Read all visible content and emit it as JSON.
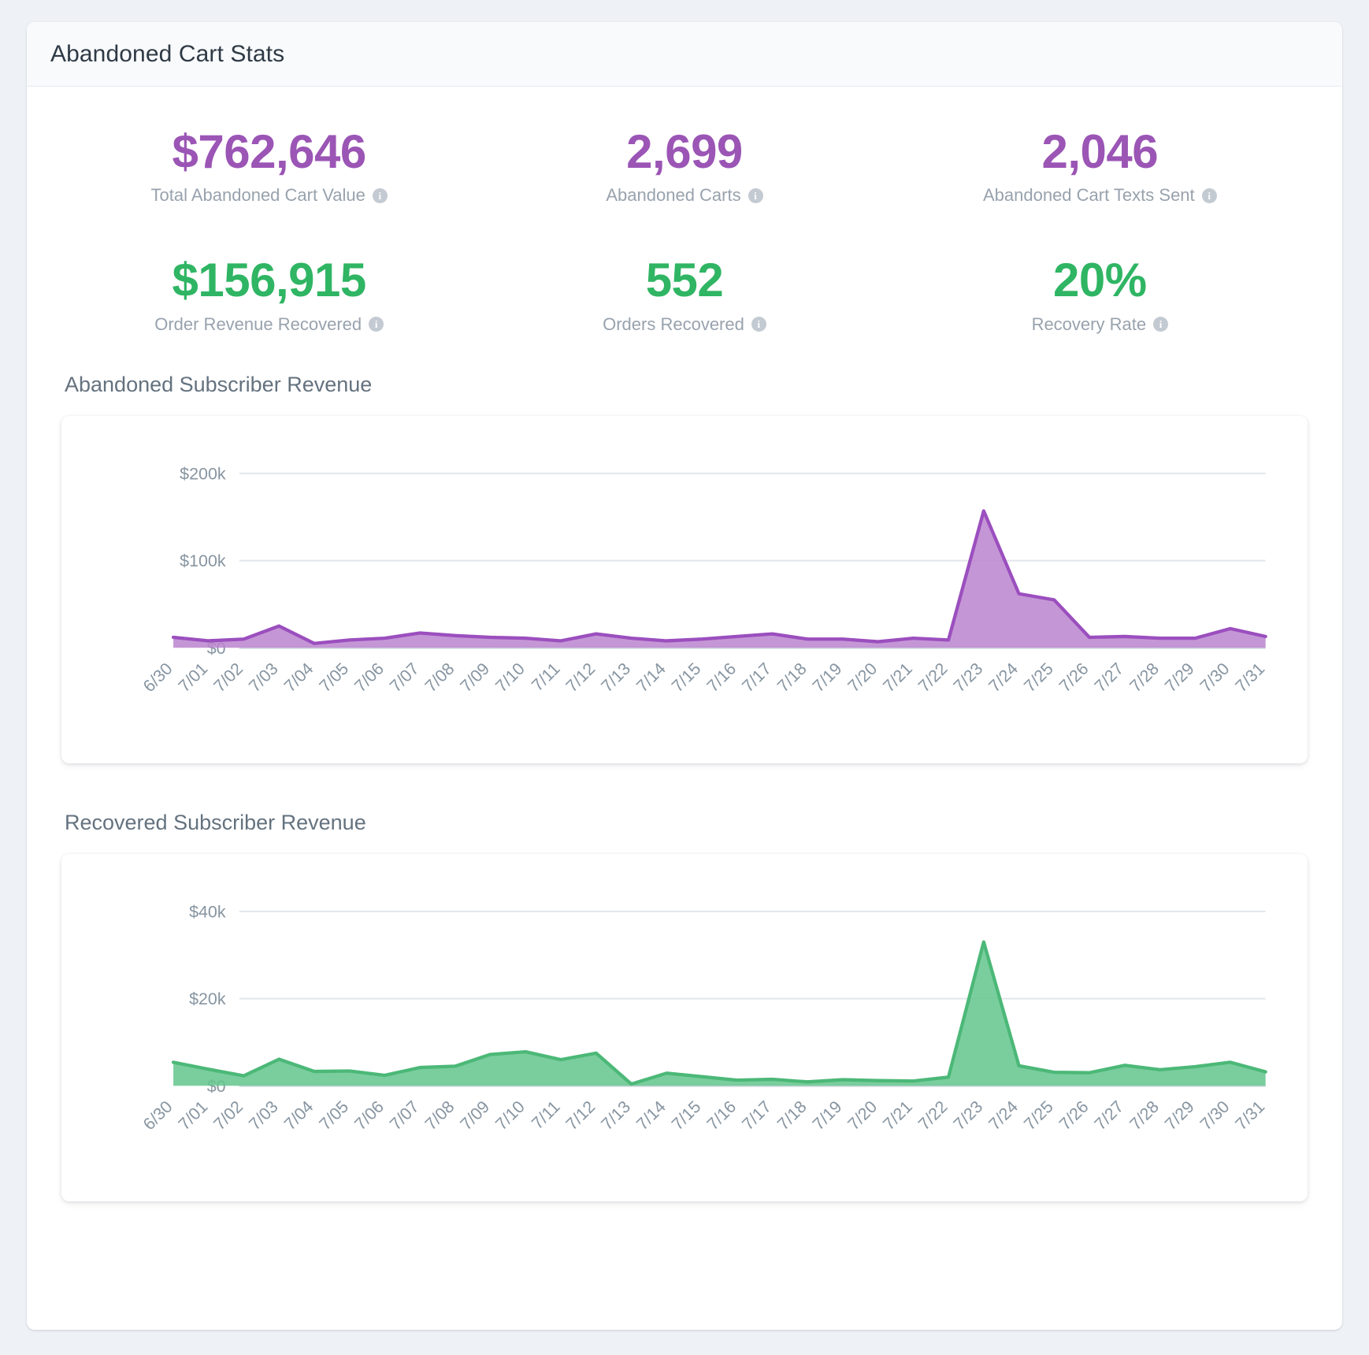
{
  "header": {
    "title": "Abandoned Cart Stats"
  },
  "stats": [
    {
      "value": "$762,646",
      "label": "Total Abandoned Cart Value",
      "color": "purple",
      "info": "info-icon"
    },
    {
      "value": "2,699",
      "label": "Abandoned Carts",
      "color": "purple",
      "info": "info-icon"
    },
    {
      "value": "2,046",
      "label": "Abandoned Cart Texts Sent",
      "color": "purple",
      "info": "info-icon"
    },
    {
      "value": "$156,915",
      "label": "Order Revenue Recovered",
      "color": "green",
      "info": "info-icon"
    },
    {
      "value": "552",
      "label": "Orders Recovered",
      "color": "green",
      "info": "info-icon"
    },
    {
      "value": "20%",
      "label": "Recovery Rate",
      "color": "green",
      "info": "info-icon"
    }
  ],
  "colors": {
    "purple_value": "#9b55b5",
    "green_value": "#2fb563",
    "purple_line": "#9b4fbe",
    "purple_fill": "#bb84cf",
    "green_line": "#4cb878",
    "green_fill": "#63c68c",
    "grid": "#e4e8ec",
    "axis_text": "#8795a1"
  },
  "chart_data": [
    {
      "type": "area",
      "title": "Abandoned Subscriber Revenue",
      "xlabel": "",
      "ylabel": "",
      "ylim": [
        0,
        225000
      ],
      "yticks": [
        0,
        100000,
        200000
      ],
      "ytick_labels": [
        "$0",
        "$100k",
        "$200k"
      ],
      "grid": true,
      "legend": "none",
      "series_color": "#bb84cf",
      "line_color": "#9b4fbe",
      "categories": [
        "6/30",
        "7/01",
        "7/02",
        "7/03",
        "7/04",
        "7/05",
        "7/06",
        "7/07",
        "7/08",
        "7/09",
        "7/10",
        "7/11",
        "7/12",
        "7/13",
        "7/14",
        "7/15",
        "7/16",
        "7/17",
        "7/18",
        "7/19",
        "7/20",
        "7/21",
        "7/22",
        "7/23",
        "7/24",
        "7/25",
        "7/26",
        "7/27",
        "7/28",
        "7/29",
        "7/30",
        "7/31"
      ],
      "values": [
        12000,
        8000,
        10000,
        25000,
        5000,
        9000,
        11000,
        17000,
        14000,
        12000,
        11000,
        8000,
        16000,
        11000,
        8000,
        10000,
        13000,
        16000,
        10000,
        10000,
        7000,
        11000,
        9000,
        157000,
        62000,
        55000,
        12000,
        13000,
        11000,
        11000,
        22000,
        13000
      ]
    },
    {
      "type": "area",
      "title": "Recovered Subscriber Revenue",
      "xlabel": "",
      "ylabel": "",
      "ylim": [
        0,
        45000
      ],
      "yticks": [
        0,
        20000,
        40000
      ],
      "ytick_labels": [
        "$0",
        "$20k",
        "$40k"
      ],
      "grid": true,
      "legend": "none",
      "series_color": "#63c68c",
      "line_color": "#4cb878",
      "categories": [
        "6/30",
        "7/01",
        "7/02",
        "7/03",
        "7/04",
        "7/05",
        "7/06",
        "7/07",
        "7/08",
        "7/09",
        "7/10",
        "7/11",
        "7/12",
        "7/13",
        "7/14",
        "7/15",
        "7/16",
        "7/17",
        "7/18",
        "7/19",
        "7/20",
        "7/21",
        "7/22",
        "7/23",
        "7/24",
        "7/25",
        "7/26",
        "7/27",
        "7/28",
        "7/29",
        "7/30",
        "7/31"
      ],
      "values": [
        5400,
        3800,
        2300,
        6100,
        3300,
        3400,
        2400,
        4200,
        4500,
        7200,
        7800,
        6000,
        7500,
        400,
        2900,
        2100,
        1300,
        1500,
        900,
        1400,
        1200,
        1100,
        2000,
        33000,
        4600,
        3100,
        3000,
        4700,
        3700,
        4400,
        5400,
        3200
      ]
    }
  ]
}
